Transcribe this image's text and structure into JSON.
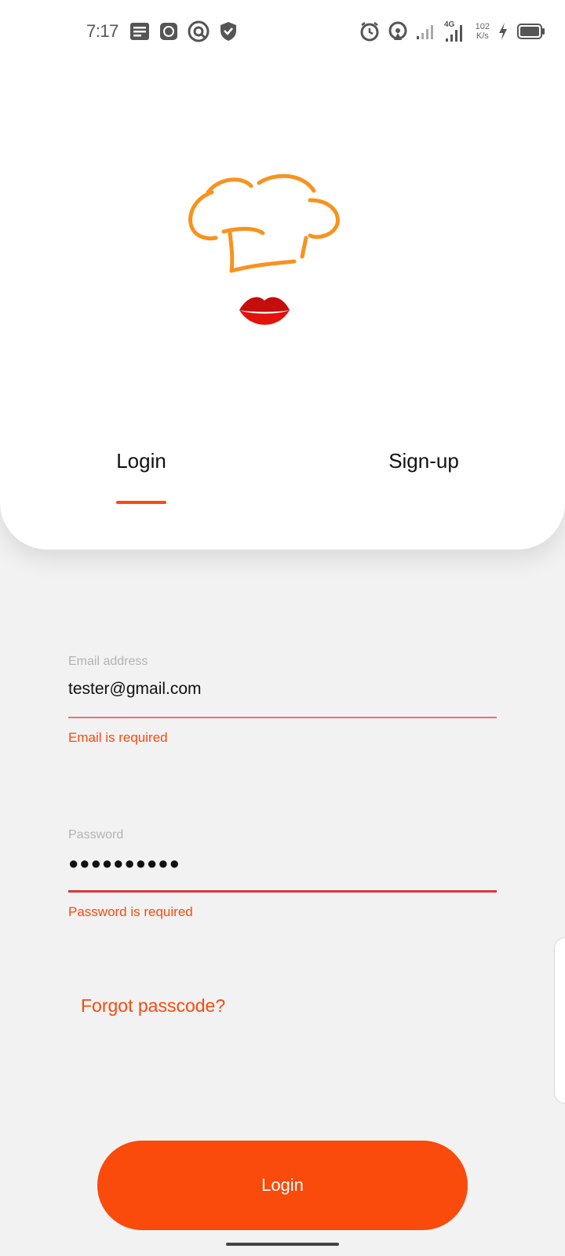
{
  "status_bar": {
    "time": "7:17",
    "net_speed_value": "102",
    "net_speed_unit": "K/s",
    "network_type": "4G",
    "icons_left": [
      "notes-icon",
      "app-icon",
      "vpn-icon",
      "shield-icon"
    ],
    "icons_right": [
      "alarm-icon",
      "hotspot-icon",
      "signal-icon",
      "signal-4g-icon",
      "charging-icon",
      "battery-icon"
    ]
  },
  "tabs": {
    "login": "Login",
    "signup": "Sign-up",
    "active": "login"
  },
  "form": {
    "email_label": "Email address",
    "email_value": "tester@gmail.com",
    "email_error": "Email is required",
    "password_label": "Password",
    "password_value": "●●●●●●●●●●",
    "password_error": "Password is required"
  },
  "forgot_link": "Forgot passcode?",
  "login_button": "Login",
  "colors": {
    "accent": "#FA4A0C",
    "background": "#F2F2F2",
    "card": "#FFFFFF",
    "error_line": "#D8383B",
    "logo_hat": "#F7931E",
    "logo_lips": "#E3120B"
  }
}
